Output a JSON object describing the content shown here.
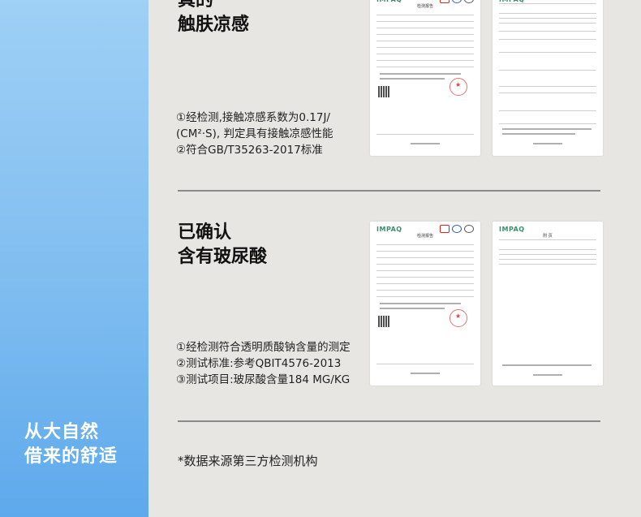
{
  "sidebar": {
    "title_line1": "从大自然",
    "title_line2": "借来的舒适"
  },
  "section1": {
    "heading_line1": "真的",
    "heading_line2": "触肤凉感",
    "points": [
      "①经检测,接触凉感系数为0.17J/",
      "(CM²·S), 判定具有接触凉感性能",
      "②符合GB/T35263-2017标准"
    ]
  },
  "section2": {
    "heading_line1": "已确认",
    "heading_line2": "含有玻尿酸",
    "points": [
      "①经检测符合透明质酸钠含量的测定",
      "②测试标准:参考QBIT4576-2013",
      "③测试项目:玻尿酸含量184 MG/KG"
    ]
  },
  "docs": {
    "logo": "IMPAQ",
    "report_title": "检测报告",
    "appendix_title": "附 页"
  },
  "footnote": "*数据来源第三方检测机构"
}
